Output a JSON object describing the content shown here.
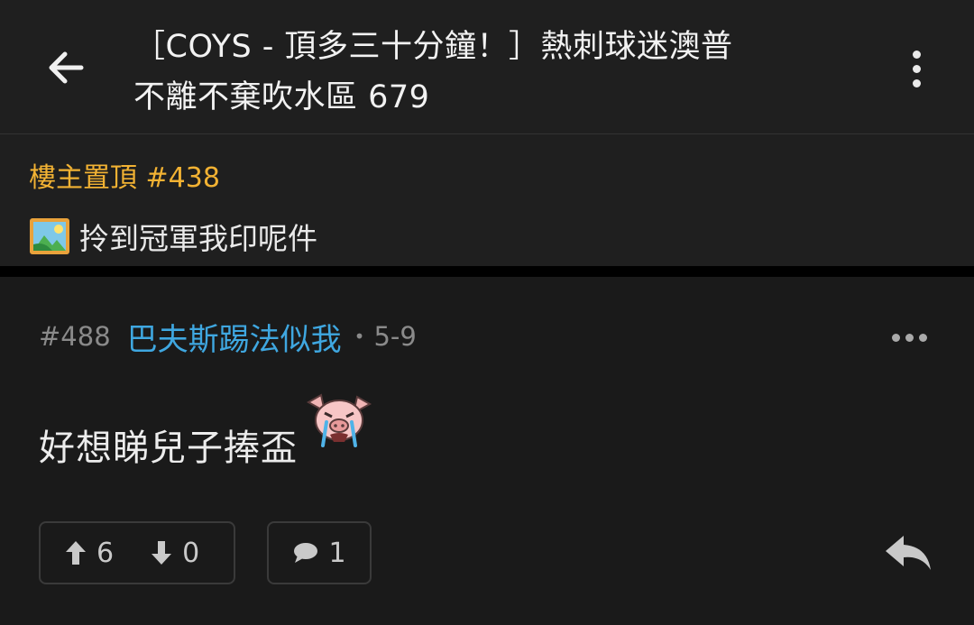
{
  "header": {
    "title_line1": "［COYS -  頂多三十分鐘！］熱刺球迷澳普",
    "title_line2": "不離不棄吹水區 679",
    "back_icon": "arrow-left-icon",
    "menu_icon": "more-vertical-icon"
  },
  "pinned": {
    "label": "樓主置頂 #438",
    "text": "拎到冠軍我印呢件",
    "icon": "image-icon",
    "label_color": "#f2b233"
  },
  "post": {
    "number": "#488",
    "author": "巴夫斯踢法似我",
    "separator": "•",
    "date": "5-9",
    "body": "好想睇兒子捧盃",
    "emoji": "crying-pig-emoji",
    "author_color": "#3fa7e0",
    "upvotes": "6",
    "downvotes": "0",
    "comments": "1",
    "more_icon": "more-horizontal-icon",
    "reply_icon": "reply-icon"
  }
}
